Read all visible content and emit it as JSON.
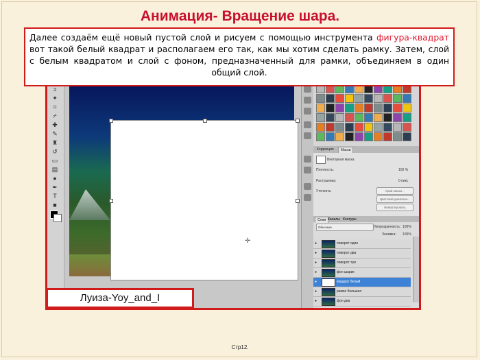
{
  "slide": {
    "title": "Анимация- Вращение шара.",
    "instruction_before": "Далее создаём ещё новый пустой слой и рисуем с помощью инструмента ",
    "instruction_highlight": "фигура-квадрат",
    "instruction_after": " вот такой белый квадрат и располагаем его так, как мы хотим сделать рамку. Затем, слой с белым квадратом и слой с фоном, предназначенный для рамки, объединяем в один общий слой.",
    "author": "Луиза-Yoy_and_I",
    "page": "Стр12.",
    "colors": {
      "accent": "#d11a1a",
      "highlight": "#e0152b",
      "background": "#faf1dc"
    }
  },
  "photoshop": {
    "tabs": [
      "Коррекция",
      "Маски"
    ],
    "mask_panel": {
      "title": "Векторная маска",
      "density_label": "Плотность:",
      "density_value": "100 %",
      "feather_label": "Растушевка:",
      "feather_value": "0 пикс",
      "refine_label": "Уточнить:",
      "buttons": [
        "Край маски...",
        "Цветовой диапазон...",
        "Инвертировать"
      ]
    },
    "layers_panel": {
      "tabs": [
        "Слои",
        "Каналы",
        "Контуры"
      ],
      "blend_mode": "Обычные",
      "opacity_label": "Непрозрачность:",
      "opacity_value": "100%",
      "fill_label": "Заливка:",
      "fill_value": "100%",
      "layers": [
        {
          "name": "поворот один",
          "selected": false,
          "white": false
        },
        {
          "name": "поворот два",
          "selected": false,
          "white": false
        },
        {
          "name": "поворот три",
          "selected": false,
          "white": false
        },
        {
          "name": "фон шарик",
          "selected": false,
          "white": false
        },
        {
          "name": "квадрат белый",
          "selected": true,
          "white": true
        },
        {
          "name": "рамка большая",
          "selected": false,
          "white": false
        },
        {
          "name": "фон два",
          "selected": false,
          "white": false
        }
      ]
    }
  }
}
